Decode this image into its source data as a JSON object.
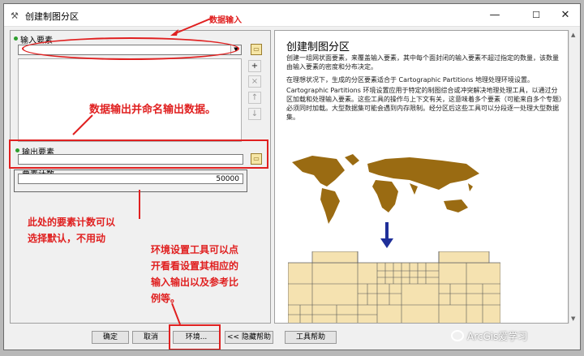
{
  "window": {
    "title": "创建制图分区"
  },
  "left": {
    "input_label": "输入要素",
    "output_label": "输出要素",
    "count_label": "要素计数",
    "count_value": "50000"
  },
  "side_buttons": [
    "+",
    "×",
    "↑",
    "↓"
  ],
  "annotations": {
    "data_input": "数据输入",
    "output_note": "数据输出并命名输出数据。",
    "count_note": "此处的要素计数可以\n选择默认，不用动",
    "env_note": "环境设置工具可以点\n开看看设置其相应的\n输入输出以及参考比\n例等。"
  },
  "help": {
    "title": "创建制图分区",
    "para1": "创建一组网状面要素，来覆盖输入要素，其中每个面封闭的输入要素不超过指定的数量，该数量由输入要素的密度和分布决定。",
    "para2": "在理想状况下，生成的分区要素适合于 Cartographic Partitions 地理处理环境设置。",
    "para3": "Cartographic Partitions 环境设置应用于特定的制图综合或冲突解决地理处理工具，以通过分区加载和处理输入要素。这些工具的操作与上下文有关，这意味着多个要素（可能来自多个专题）必须同时加载。大型数据集可能会遇到内存限制。经分区后这些工具可以分段逐一处理大型数据集。"
  },
  "buttons": {
    "ok": "确定",
    "cancel": "取消",
    "env": "环境...",
    "hide_help": "<< 隐藏帮助",
    "tool_help": "工具帮助"
  },
  "watermark": "ArcGis爱学习",
  "colors": {
    "annotation": "#e02020",
    "land": "#9a6b12",
    "grid_fill": "#f5e2b0",
    "arrow": "#1f2f99"
  }
}
